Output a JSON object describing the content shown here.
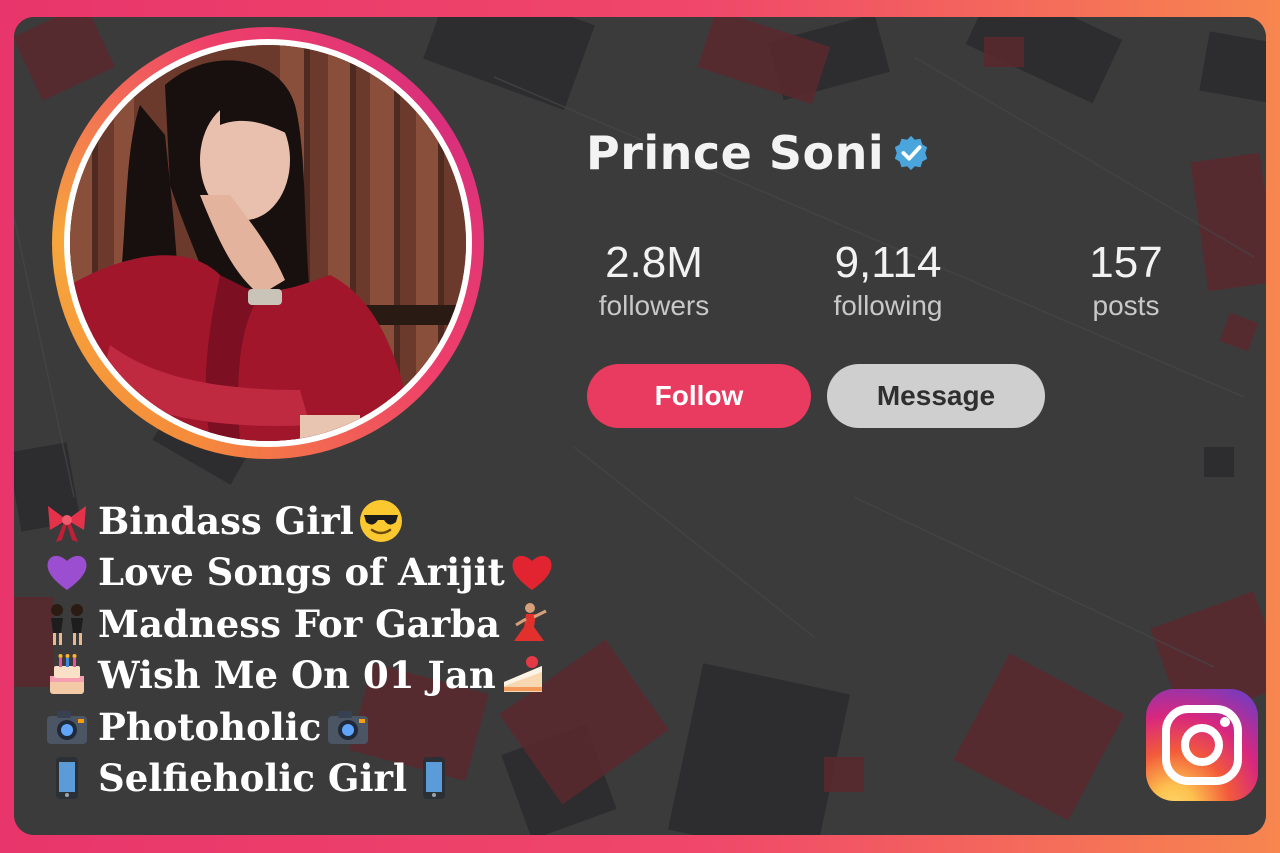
{
  "profile": {
    "name": "Prince Soni",
    "verified": true,
    "avatar_icon": "profile-photo"
  },
  "stats": [
    {
      "value": "2.8M",
      "label": "followers"
    },
    {
      "value": "9,114",
      "label": "following"
    },
    {
      "value": "157",
      "label": "posts"
    }
  ],
  "actions": {
    "follow_label": "Follow",
    "message_label": "Message"
  },
  "bio": [
    {
      "text": "Bindass Girl",
      "lead_icon": "ribbon-icon",
      "trail_icon": "sunglasses-face-icon"
    },
    {
      "text": "Love Songs of Arijit",
      "lead_icon": "purple-heart-icon",
      "trail_icon": "red-heart-icon"
    },
    {
      "text": "Madness For Garba",
      "lead_icon": "dancers-icon",
      "trail_icon": "dancer-icon"
    },
    {
      "text": "Wish Me On 01 Jan",
      "lead_icon": "birthday-cake-icon",
      "trail_icon": "cake-slice-icon"
    },
    {
      "text": "Photoholic ",
      "lead_icon": "camera-icon",
      "trail_icon": "camera-icon"
    },
    {
      "text": "Selfieholic Girl",
      "lead_icon": "mobile-phone-icon",
      "trail_icon": "mobile-phone-icon"
    }
  ],
  "brand": {
    "logo_icon": "instagram-icon",
    "accent": "#e93a5f",
    "frame_gradient": [
      "#e8356b",
      "#f7864f"
    ]
  }
}
